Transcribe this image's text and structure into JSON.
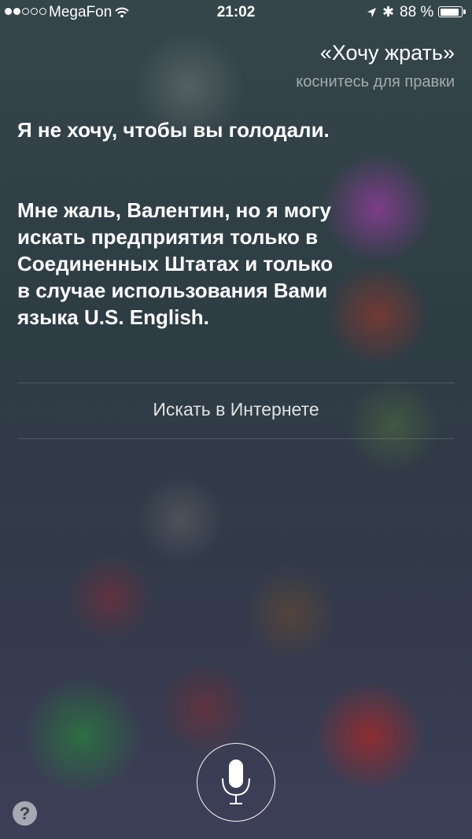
{
  "status_bar": {
    "carrier": "MegaFon",
    "signal_bars_filled": 2,
    "signal_bars_total": 5,
    "time": "21:02",
    "battery_percent": "88 %",
    "icons": [
      "signal-dots-icon",
      "wifi-icon",
      "location-arrow-icon",
      "bluetooth-icon",
      "battery-icon"
    ]
  },
  "query": {
    "text": "«Хочу жрать»",
    "edit_hint": "коснитесь для правки"
  },
  "response": {
    "line1": "Я не хочу, чтобы вы голодали.",
    "line2": "Мне жаль, Валентин, но я могу искать предприятия только в Соединенных Штатах и только в случае использования Вами языка U.S. English."
  },
  "actions": {
    "search_web": "Искать в Интернете"
  },
  "controls": {
    "mic_icon": "microphone-icon",
    "help_label": "?"
  }
}
